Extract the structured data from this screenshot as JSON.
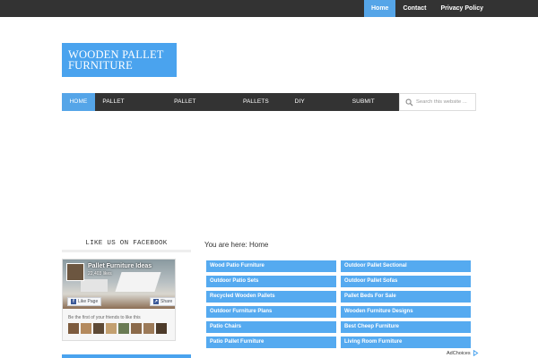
{
  "top_nav": {
    "items": [
      {
        "label": "Home",
        "active": true
      },
      {
        "label": "Contact",
        "active": false
      },
      {
        "label": "Privacy Policy",
        "active": false
      }
    ]
  },
  "logo": {
    "line1": "WOODEN PALLET",
    "line2": "FURNITURE"
  },
  "main_nav": {
    "items": [
      {
        "label": "HOME",
        "active": true
      },
      {
        "label": "PALLET FURNITURE",
        "active": false
      },
      {
        "label": "PALLET PROJECTS",
        "active": false
      },
      {
        "label": "PALLETS DIY",
        "active": false
      },
      {
        "label": "DIY PROJECTS",
        "active": false
      },
      {
        "label": "SUBMIT POST",
        "active": false
      }
    ]
  },
  "search": {
    "placeholder": "Search this website ...",
    "icon": "search-icon"
  },
  "sidebar": {
    "widget_title": "LIKE US ON FACEBOOK",
    "facebook": {
      "page_name": "Pallet Furniture Ideas",
      "likes": "22,403 likes",
      "like_label": "Like Page",
      "share_label": "Share",
      "friends_text": "Be the first of your friends to like this"
    }
  },
  "content": {
    "breadcrumb": "You are here: Home",
    "links": [
      "Wood Patio Furniture",
      "Outdoor Pallet Sectional",
      "Outdoor Patio Sets",
      "Outdoor Pallet Sofas",
      "Recycled Wooden Pallets",
      "Pallet Beds For Sale",
      "Outdoor Furniture Plans",
      "Wooden Furniture Designs",
      "Patio Chairs",
      "Best Cheep Furniture",
      "Patio Pallet Furniture",
      "Living Room Furniture"
    ]
  },
  "ad": {
    "label": "AdChoices"
  },
  "colors": {
    "accent": "#55a5e8",
    "nav_bg": "#333333",
    "link_tile": "#55aaf0"
  }
}
